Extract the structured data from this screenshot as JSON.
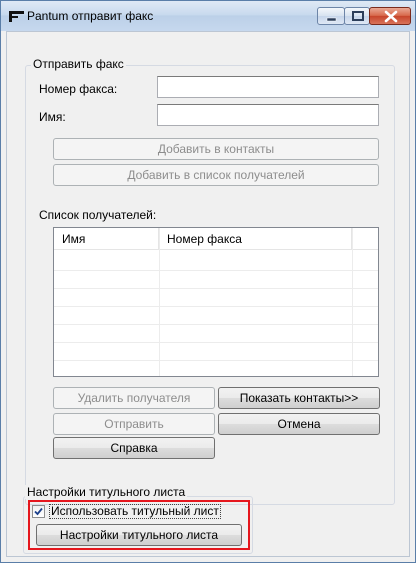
{
  "window": {
    "title": "Pantum отправит факс"
  },
  "send_fax": {
    "group_title": "Отправить факс",
    "fax_number_label": "Номер факса:",
    "fax_number_value": "",
    "name_label": "Имя:",
    "name_value": "",
    "add_to_contacts": "Добавить в контакты",
    "add_to_recipients": "Добавить в список получателей"
  },
  "recipients": {
    "label": "Список получателей:",
    "columns": [
      "Имя",
      "Номер факса"
    ],
    "rows": []
  },
  "actions": {
    "remove_recipient": "Удалить получателя",
    "show_contacts": "Показать контакты>>",
    "send": "Отправить",
    "cancel": "Отмена",
    "help": "Справка"
  },
  "cover_page": {
    "group_title": "Настройки титульного листа",
    "use_cover_label": "Использовать титульный лист",
    "use_cover_checked": true,
    "settings_button": "Настройки титульного листа"
  },
  "colors": {
    "highlight": "#e5161d",
    "title_bar": "#c9daee",
    "close_button": "#c7442a"
  }
}
